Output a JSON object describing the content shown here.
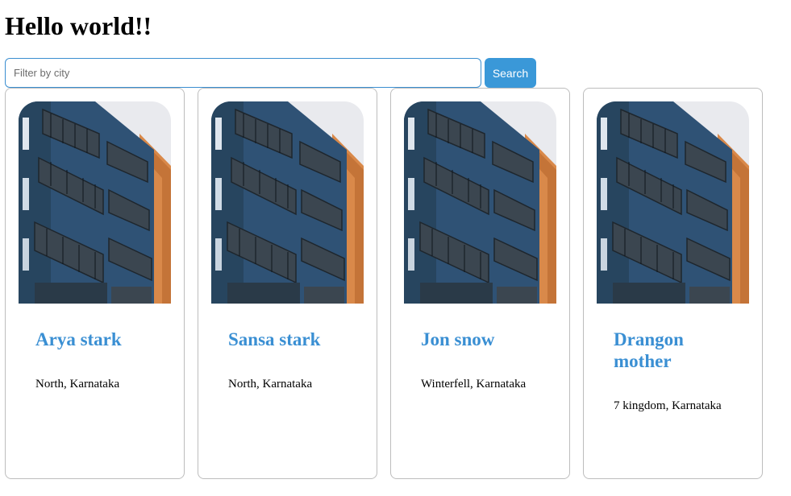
{
  "header": {
    "title": "Hello world!!"
  },
  "search": {
    "placeholder": "Filter by city",
    "value": "",
    "button_label": "Search"
  },
  "cards": [
    {
      "name": "Arya stark",
      "location": "North, Karnataka",
      "image": "apartment-building-photo"
    },
    {
      "name": "Sansa stark",
      "location": "North, Karnataka",
      "image": "apartment-building-photo"
    },
    {
      "name": "Jon snow",
      "location": "Winterfell, Karnataka",
      "image": "apartment-building-photo"
    },
    {
      "name": "Drangon mother",
      "location": "7 kingdom, Karnataka",
      "image": "apartment-building-photo"
    }
  ],
  "colors": {
    "accent": "#3a98d8",
    "name_text": "#3a8fd3",
    "border": "#bdbdbd"
  }
}
